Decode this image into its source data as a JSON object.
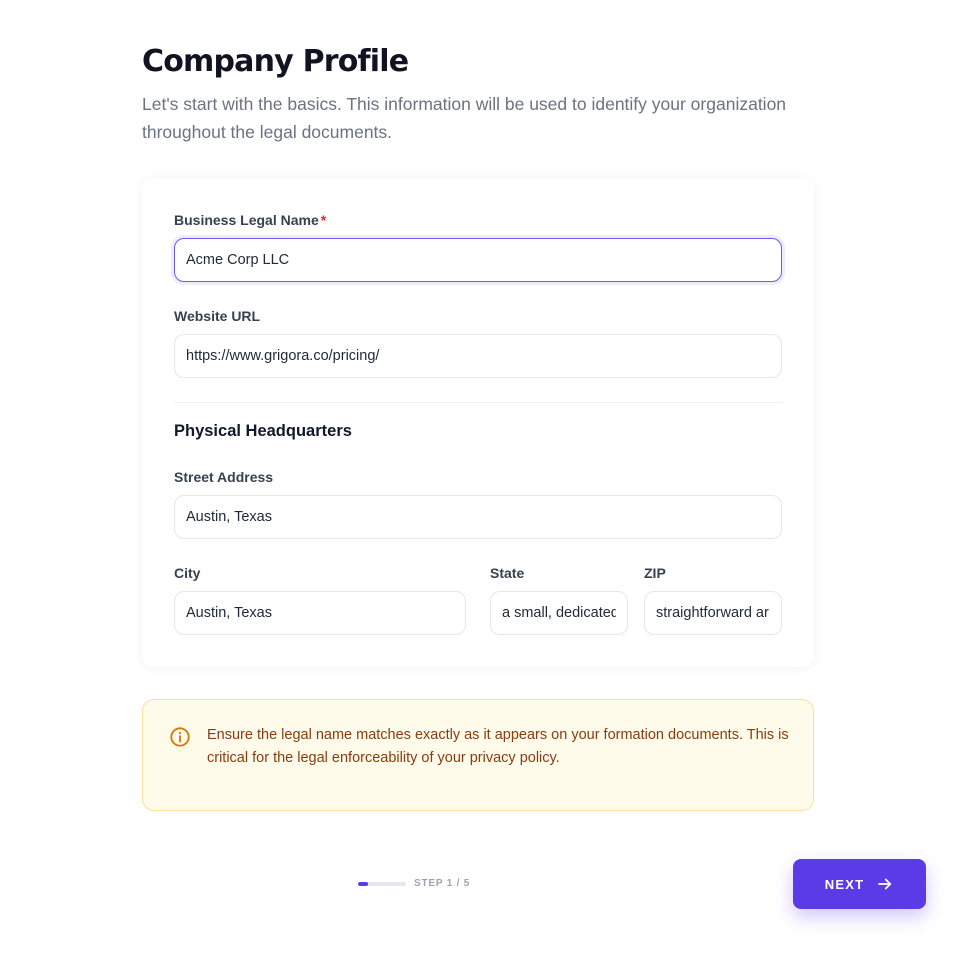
{
  "header": {
    "title": "Company Profile",
    "subtitle": "Let's start with the basics. This information will be used to identify your organization throughout the legal documents."
  },
  "form": {
    "legal_name": {
      "label": "Business Legal Name",
      "required_mark": "*",
      "value": "Acme Corp LLC"
    },
    "website": {
      "label": "Website URL",
      "value": "https://www.grigora.co/pricing/"
    },
    "headquarters_heading": "Physical Headquarters",
    "street": {
      "label": "Street Address",
      "value": "Austin, Texas"
    },
    "city": {
      "label": "City",
      "value": "Austin, Texas"
    },
    "state": {
      "label": "State",
      "value": "a small, dedicated"
    },
    "zip": {
      "label": "ZIP",
      "value": "straightforward ar"
    }
  },
  "callout": {
    "icon": "info-circle-icon",
    "text": "Ensure the legal name matches exactly as it appears on your formation documents. This is critical for the legal enforceability of your privacy policy."
  },
  "footer": {
    "step_label": "STEP 1 / 5",
    "progress_fraction": 0.2,
    "next_label": "NEXT",
    "next_icon": "arrow-right-icon"
  },
  "colors": {
    "accent": "#5b3ae8",
    "required": "#dc2626",
    "callout_bg": "#fefbea",
    "callout_text": "#8a3c10"
  }
}
